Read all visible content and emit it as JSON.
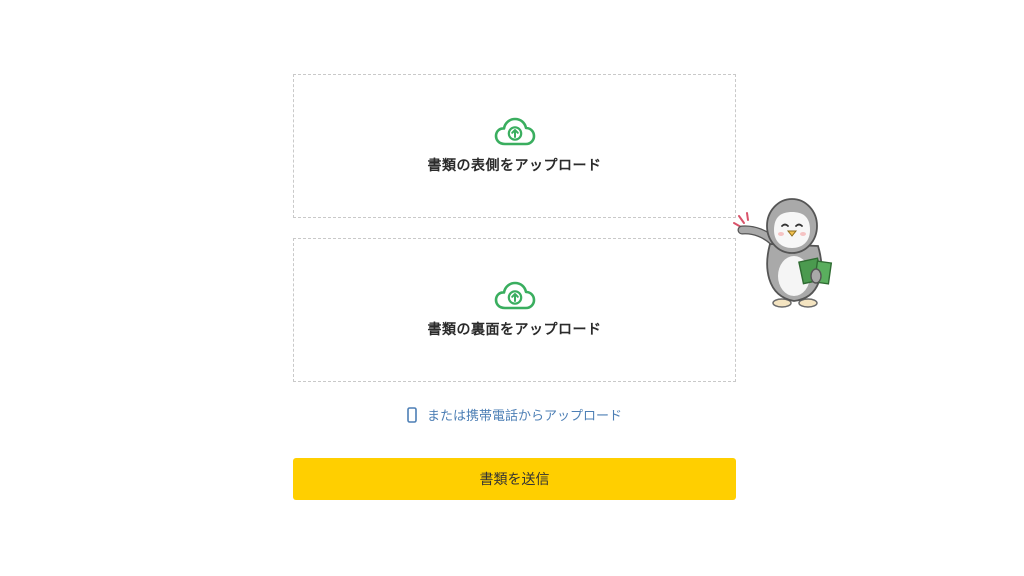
{
  "upload_front": {
    "label": "書類の表側をアップロード",
    "icon": "cloud-upload-icon"
  },
  "upload_back": {
    "label": "書類の裏面をアップロード",
    "icon": "cloud-upload-icon"
  },
  "mobile_upload": {
    "label": "または携帯電話からアップロード",
    "icon": "smartphone-icon"
  },
  "submit": {
    "label": "書類を送信"
  },
  "colors": {
    "accent_green": "#3aae5f",
    "button_yellow": "#ffcf00",
    "link_blue": "#4d7fb5",
    "dashed_border": "#c9c9c9"
  }
}
